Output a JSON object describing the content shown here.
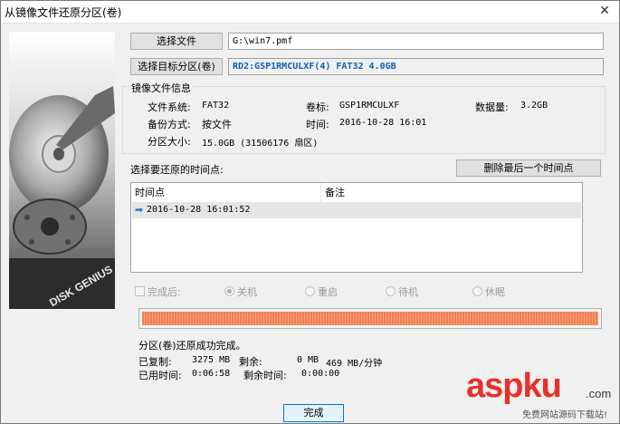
{
  "window": {
    "title": "从镜像文件还原分区(卷)"
  },
  "top": {
    "select_file_label": "选择文件",
    "file_path": "G:\\win7.pmf",
    "select_target_label": "选择目标分区(卷)",
    "target_value": "RD2:GSP1RMCULXF(4) FAT32 4.0GB"
  },
  "info": {
    "group_title": "镜像文件信息",
    "fs_label": "文件系统:",
    "fs_value": "FAT32",
    "vol_label": "卷标:",
    "vol_value": "GSP1RMCULXF",
    "size_label": "数据量:",
    "size_value": "3.2GB",
    "backup_label": "备份方式:",
    "backup_value": "按文件",
    "time_label": "时间:",
    "time_value": "2016-10-28 16:01",
    "part_label": "分区大小:",
    "part_value": "15.0GB  (31506176 扇区)"
  },
  "timepoints": {
    "prompt": "选择要还原的时间点:",
    "delete_label": "删除最后一个时间点",
    "col_time": "时间点",
    "col_note": "备注",
    "rows": [
      {
        "time": "2016-10-28 16:01:52",
        "note": ""
      }
    ]
  },
  "after": {
    "label": "完成后:",
    "options": [
      "关机",
      "重启",
      "待机",
      "休眠"
    ],
    "selected": "关机"
  },
  "progress": {
    "fraction": 1.0,
    "accent": "#f08050"
  },
  "status": {
    "message": "分区(卷)还原成功完成。",
    "copied_label": "已复制:",
    "copied_value": "3275 MB",
    "remain_label": "剩余:",
    "remain_value": "0 MB",
    "speed_value": "469 MB/分钟",
    "elapsed_label": "已用时间:",
    "elapsed_value": "0:06:58",
    "remain_time_label": "剩余时间:",
    "remain_time_value": "0:00:00"
  },
  "footer": {
    "finish_label": "完成"
  },
  "brand": {
    "disk_text": "DISK GENIUS"
  },
  "watermark": {
    "main": "aspku",
    "sub": ".com",
    "caption": "免费网站源码下载站!"
  }
}
